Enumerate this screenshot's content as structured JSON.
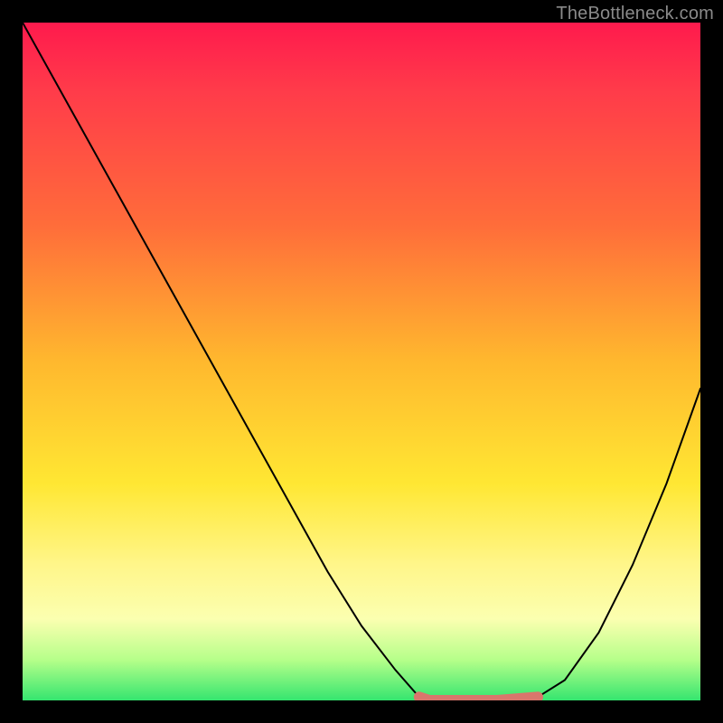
{
  "watermark": "TheBottleneck.com",
  "chart_data": {
    "type": "line",
    "series": [
      {
        "name": "bottleneck-curve",
        "x": [
          0.0,
          0.05,
          0.1,
          0.15,
          0.2,
          0.25,
          0.3,
          0.35,
          0.4,
          0.45,
          0.5,
          0.55,
          0.585,
          0.6,
          0.64,
          0.7,
          0.76,
          0.8,
          0.85,
          0.9,
          0.95,
          1.0
        ],
        "y": [
          1.0,
          0.91,
          0.82,
          0.73,
          0.64,
          0.55,
          0.46,
          0.37,
          0.28,
          0.19,
          0.11,
          0.045,
          0.005,
          0.0,
          0.0,
          0.0,
          0.005,
          0.03,
          0.1,
          0.2,
          0.32,
          0.46
        ]
      },
      {
        "name": "optimal-zone-highlight",
        "x": [
          0.585,
          0.6,
          0.64,
          0.7,
          0.76
        ],
        "y": [
          0.005,
          0.0,
          0.0,
          0.0,
          0.005
        ]
      }
    ],
    "xlim": [
      0,
      1
    ],
    "ylim": [
      0,
      1
    ],
    "xlabel": "",
    "ylabel": "",
    "title": ""
  },
  "colors": {
    "curve": "#000000",
    "highlight": "#d9766c",
    "gradient_top": "#ff1a4d",
    "gradient_bottom": "#35e56f"
  }
}
